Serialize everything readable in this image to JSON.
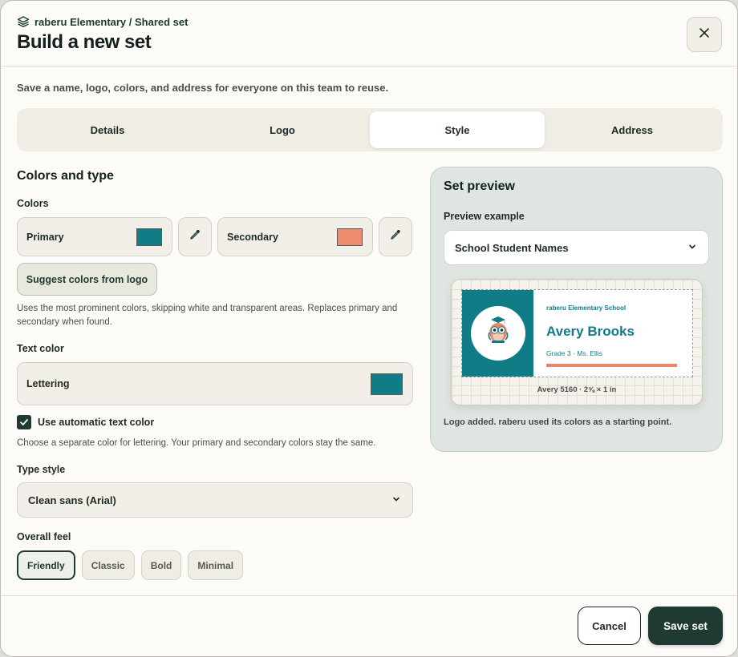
{
  "header": {
    "breadcrumb": "raberu Elementary / Shared set",
    "breadcrumb_icon": "layers-icon",
    "title": "Build a new set",
    "close_icon": "close-icon"
  },
  "subtitle": "Save a name, logo, colors, and address for everyone on this team to reuse.",
  "tabs": [
    {
      "label": "Details",
      "active": false
    },
    {
      "label": "Logo",
      "active": false
    },
    {
      "label": "Style",
      "active": true
    },
    {
      "label": "Address",
      "active": false
    }
  ],
  "style": {
    "heading": "Colors and type",
    "colors_label": "Colors",
    "primary": {
      "label": "Primary",
      "color": "#0f7c86"
    },
    "secondary": {
      "label": "Secondary",
      "color": "#ef8c6f"
    },
    "suggest_button": "Suggest colors from logo",
    "suggest_help": "Uses the most prominent colors, skipping white and transparent areas. Replaces primary and secondary when found.",
    "text_color_label": "Text color",
    "lettering": {
      "label": "Lettering",
      "color": "#0f7c86"
    },
    "auto_text_color": {
      "label": "Use automatic text color",
      "checked": true
    },
    "auto_text_help": "Choose a separate color for lettering. Your primary and secondary colors stay the same.",
    "type_style_label": "Type style",
    "type_style_value": "Clean sans (Arial)",
    "overall_feel_label": "Overall feel",
    "feel_options": [
      {
        "label": "Friendly",
        "active": true
      },
      {
        "label": "Classic",
        "active": false
      },
      {
        "label": "Bold",
        "active": false
      },
      {
        "label": "Minimal",
        "active": false
      }
    ]
  },
  "preview": {
    "heading": "Set preview",
    "example_label": "Preview example",
    "example_value": "School Student Names",
    "label": {
      "school": "raberu Elementary School",
      "student": "Avery Brooks",
      "grade": "Grade 3 · Ms. Ellis",
      "logo_text": "raberu",
      "logo_subtext": "Elementary School"
    },
    "avery": "Avery 5160 · 2⅝ × 1 in",
    "note": "Logo added. raberu used its colors as a starting point."
  },
  "footer": {
    "cancel": "Cancel",
    "save": "Save set"
  }
}
